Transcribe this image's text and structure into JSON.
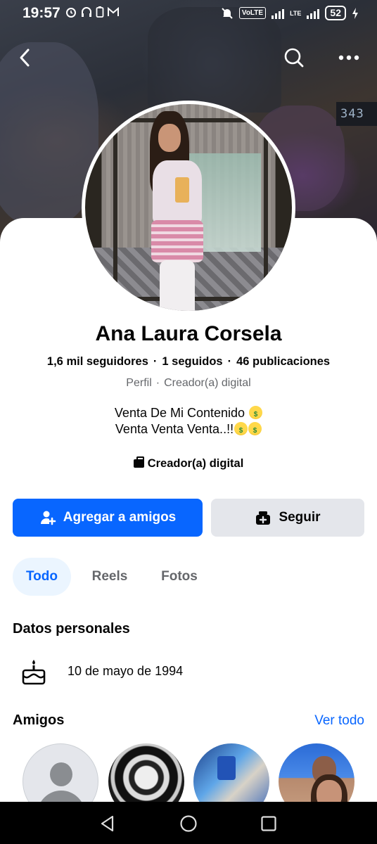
{
  "status_bar": {
    "time": "19:57",
    "network": "VoLTE",
    "lte": "LTE",
    "battery": "52"
  },
  "cover": {
    "display_text": "343"
  },
  "profile": {
    "name": "Ana Laura Corsela",
    "followers": "1,6 mil seguidores",
    "following": "1 seguidos",
    "posts": "46 publicaciones",
    "meta_profile": "Perfil",
    "meta_category": "Creador(a) digital",
    "bio_line1": "Venta De Mi Contenido",
    "bio_line2": "Venta Venta Venta..!!",
    "category": "Creador(a) digital"
  },
  "actions": {
    "add_friend_label": "Agregar a amigos",
    "follow_label": "Seguir"
  },
  "tabs": [
    {
      "label": "Todo",
      "active": true
    },
    {
      "label": "Reels",
      "active": false
    },
    {
      "label": "Fotos",
      "active": false
    }
  ],
  "personal": {
    "title": "Datos personales",
    "birthday": "10 de mayo de 1994"
  },
  "friends": {
    "title": "Amigos",
    "see_all": "Ver todo"
  },
  "colors": {
    "primary": "#0866ff",
    "secondary_button": "#e4e6eb",
    "active_tab_bg": "#ebf5ff",
    "text_primary": "#050505",
    "text_secondary": "#65676b"
  },
  "icons": {
    "back": "arrow-left-icon",
    "search": "search-icon",
    "more": "more-horizontal-icon",
    "add_friend": "person-plus-icon",
    "follow": "follow-icon",
    "birthday": "cake-icon"
  }
}
